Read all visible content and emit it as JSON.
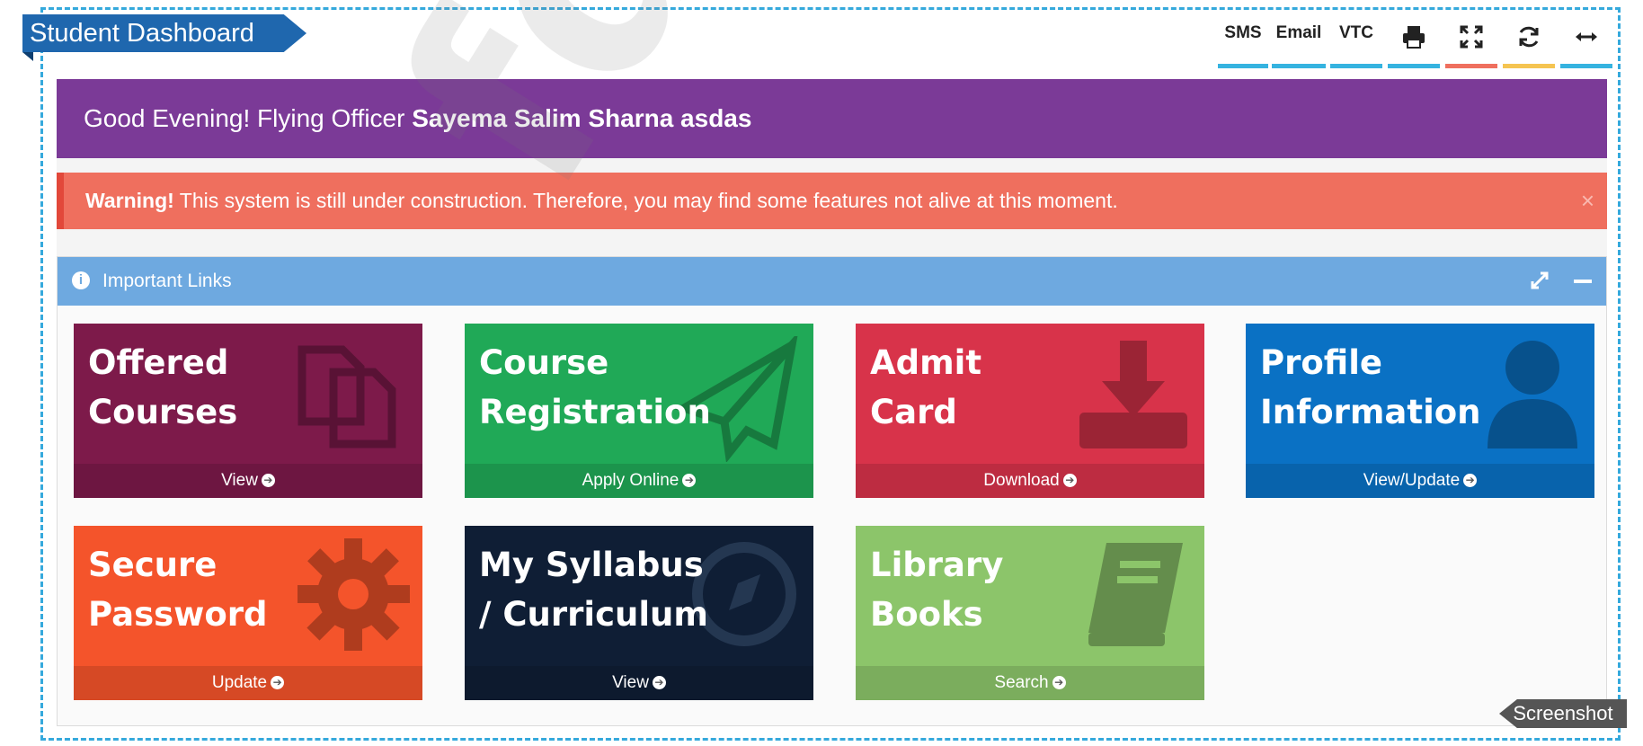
{
  "header": {
    "title": "Student Dashboard"
  },
  "toolbar": {
    "sms": "SMS",
    "email": "Email",
    "vtc": "VTC",
    "icons": [
      "print-icon",
      "fullscreen-icon",
      "refresh-icon",
      "expand-width-icon"
    ],
    "colors": {
      "blue": "#35b3e0",
      "red": "#ef6f5e",
      "yellow": "#f5c451"
    }
  },
  "greeting": {
    "prefix": "Good Evening! Flying Officer ",
    "name": "Sayema Salim Sharna asdas"
  },
  "warning": {
    "strong": "Warning!",
    "text": " This system is still under construction. Therefore, you may find some features not alive at this moment.",
    "close": "×"
  },
  "panel": {
    "title": "Important Links"
  },
  "tiles": [
    {
      "line1": "Offered",
      "line2": "Courses",
      "action": "View",
      "color": "#7d1a4a",
      "icon": "files-icon"
    },
    {
      "line1": "Course",
      "line2": "Registration",
      "action": "Apply Online",
      "color": "#20a957",
      "icon": "paper-plane-icon"
    },
    {
      "line1": "Admit",
      "line2": "Card",
      "action": "Download",
      "color": "#d8334a",
      "icon": "download-icon"
    },
    {
      "line1": "Profile",
      "line2": "Information",
      "action": "View/Update",
      "color": "#0a71c4",
      "icon": "user-icon"
    },
    {
      "line1": "Secure",
      "line2": "Password",
      "action": "Update",
      "color": "#f4542b",
      "icon": "gear-icon"
    },
    {
      "line1": "My Syllabus",
      "line2": "/ Curriculum",
      "action": "View",
      "color": "#0f1e35",
      "icon": "compass-icon"
    },
    {
      "line1": "Library",
      "line2": "Books",
      "action": "Search",
      "color": "#8cc56a",
      "icon": "book-icon"
    }
  ],
  "watermark": "fdib",
  "screenshot_tag": "Screenshot"
}
